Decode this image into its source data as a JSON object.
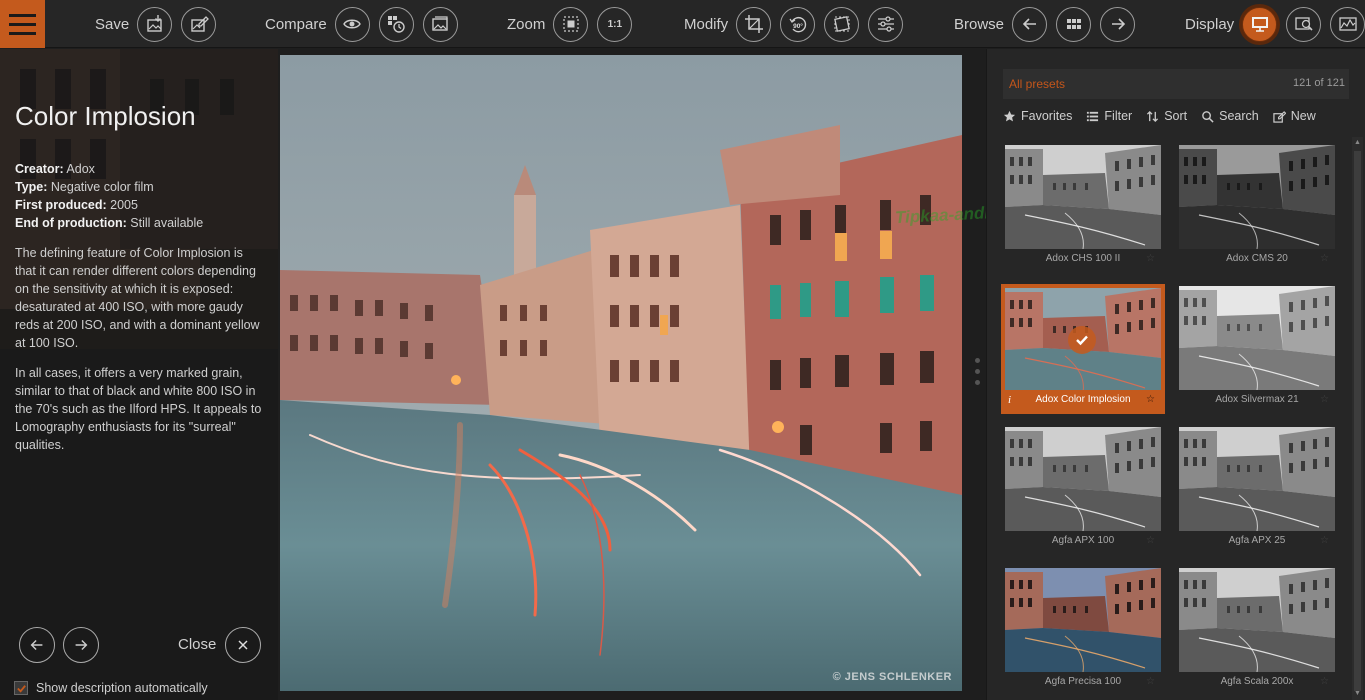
{
  "toolbar": {
    "save": "Save",
    "compare": "Compare",
    "zoom": "Zoom",
    "zoom_one": "1:1",
    "modify": "Modify",
    "rotate_label": "90°",
    "browse": "Browse",
    "display": "Display"
  },
  "preset": {
    "title": "Color Implosion",
    "creator_label": "Creator:",
    "creator": "Adox",
    "type_label": "Type:",
    "type": "Negative color film",
    "first_label": "First produced:",
    "first": "2005",
    "end_label": "End of production:",
    "end": "Still available",
    "desc1": "The defining feature of Color Implosion is that it can render different colors depending on the sensitivity at which it is exposed: desaturated at 400 ISO, with more gaudy reds at 200 ISO, and with a dominant yellow at 100 ISO.",
    "desc2": "In all cases, it offers a very marked grain, similar to that of black and white 800 ISO in the 70's such as the Ilford HPS. It appeals to Lomography enthusiasts for its \"surreal\" qualities."
  },
  "nav": {
    "close": "Close",
    "show_description": "Show description automatically"
  },
  "photo": {
    "credit": "© JENS SCHLENKER"
  },
  "watermark": "Tipkaa-android",
  "presets": {
    "header": "All presets",
    "count": "121 of 121",
    "tools": [
      "Favorites",
      "Filter",
      "Sort",
      "Search",
      "New"
    ],
    "items": [
      {
        "name": "Adox CHS 100 II",
        "style": "bw"
      },
      {
        "name": "Adox CMS 20",
        "style": "bwdark"
      },
      {
        "name": "Adox Color Implosion",
        "style": "color",
        "selected": true
      },
      {
        "name": "Adox Silvermax 21",
        "style": "bwlight"
      },
      {
        "name": "Agfa APX 100",
        "style": "bw"
      },
      {
        "name": "Agfa APX 25",
        "style": "bw"
      },
      {
        "name": "Agfa Precisa 100",
        "style": "colorblue"
      },
      {
        "name": "Agfa Scala 200x",
        "style": "bw"
      }
    ]
  },
  "colors": {
    "accent": "#c45a1d",
    "toolbar_bg": "#262626",
    "panel_bg": "#262626"
  }
}
